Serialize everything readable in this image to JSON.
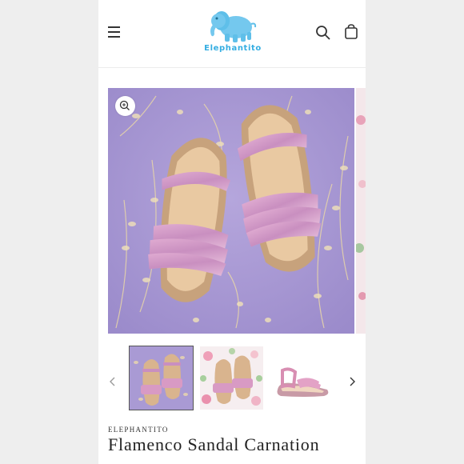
{
  "header": {
    "logo_text": "Elephantito",
    "icons": [
      "menu-icon",
      "search-icon",
      "cart-icon"
    ]
  },
  "gallery": {
    "icons": [
      "zoom-icon",
      "chevron-left-icon",
      "chevron-right-icon"
    ],
    "thumbnails": [
      "sandals-on-lavender-foliage",
      "sandals-on-floral-print",
      "single-sandal-side-view"
    ]
  },
  "product": {
    "vendor": "ELEPHANTITO",
    "title": "Flamenco Sandal Carnation"
  },
  "colors": {
    "brand_blue": "#35aee2",
    "lavender_bg": "#a99ad4",
    "sandal_pink": "#d89ac4"
  }
}
